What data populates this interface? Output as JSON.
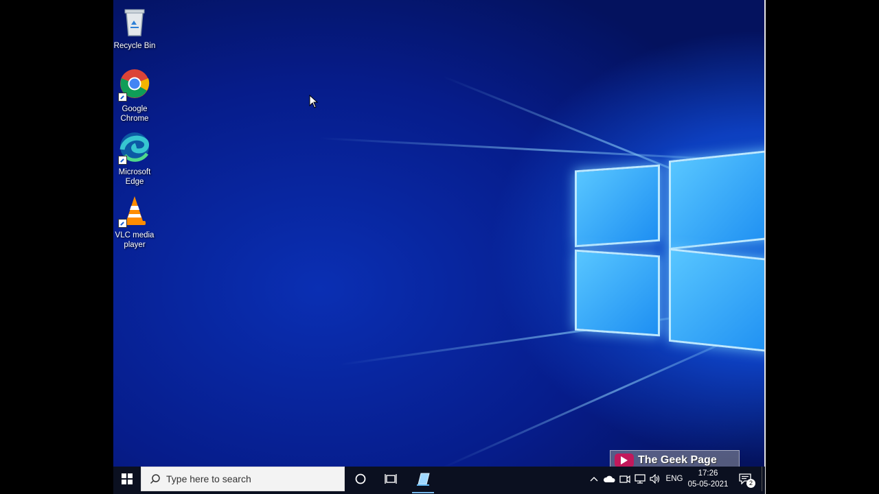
{
  "desktop": {
    "icons": [
      {
        "label": "Recycle Bin",
        "icon": "recycle-bin-icon"
      },
      {
        "label": "Google Chrome",
        "icon": "chrome-icon"
      },
      {
        "label": "Microsoft Edge",
        "icon": "edge-icon"
      },
      {
        "label": "VLC media player",
        "icon": "vlc-icon"
      }
    ]
  },
  "taskbar": {
    "start_icon": "windows-start-icon",
    "search_placeholder": "Type here to search",
    "cortana_icon": "cortana-icon",
    "task_view_icon": "task-view-icon",
    "pinned_app_icon": "taskbar-app-icon",
    "tray": {
      "language": "ENG",
      "time": "17:26",
      "date": "05-05-2021",
      "notification_count": "2"
    }
  },
  "watermark": {
    "text": "The Geek Page"
  },
  "colors": {
    "accent": "#0d3fbf",
    "taskbar": "#0b1020",
    "logo_pane": "#3fb4ff"
  }
}
